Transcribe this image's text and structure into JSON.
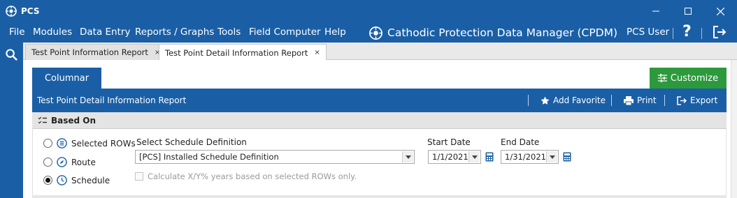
{
  "window": {
    "title": "PCS"
  },
  "menu": {
    "items": [
      "File",
      "Modules",
      "Data Entry",
      "Reports / Graphs",
      "Tools",
      "Field Computer",
      "Help"
    ]
  },
  "brand": {
    "title": "Cathodic Protection Data Manager (CPDM)"
  },
  "user": {
    "name": "PCS User"
  },
  "help": {
    "label": "?"
  },
  "tabs": [
    {
      "label": "Test Point Information Report",
      "close": "×"
    },
    {
      "label": "Test Point Detail Information Report",
      "close": "×"
    }
  ],
  "view_tab": {
    "label": "Columnar"
  },
  "customize": {
    "label": "Customize"
  },
  "report": {
    "title": "Test Point Detail Information Report",
    "actions": {
      "favorite": "Add Favorite",
      "print": "Print",
      "export": "Export"
    }
  },
  "based_on": {
    "header": "Based On",
    "options": [
      {
        "label": "Selected ROWs",
        "icon": "list-icon",
        "selected": false
      },
      {
        "label": "Route",
        "icon": "compass-icon",
        "selected": false
      },
      {
        "label": "Schedule",
        "icon": "clock-icon",
        "selected": true
      }
    ],
    "schedule_label": "Select Schedule Definition",
    "schedule_value": "[PCS] Installed Schedule Definition",
    "calc_checkbox_label": "Calculate X/Y% years based on selected ROWs only.",
    "start_date_label": "Start Date",
    "start_date": "1/1/2021",
    "end_date_label": "End Date",
    "end_date": "1/31/2021"
  },
  "colors": {
    "brand_blue": "#1a5fa6",
    "customize_green": "#2c9a3c"
  }
}
